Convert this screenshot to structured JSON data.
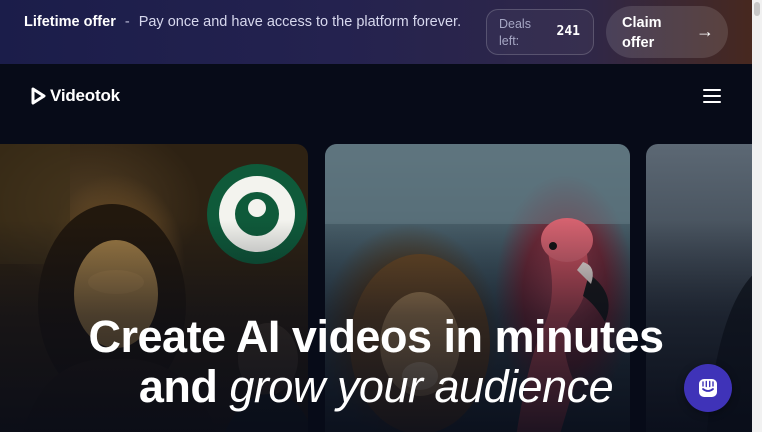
{
  "promo": {
    "title": "Lifetime offer",
    "separator": "-",
    "message": "Pay once and have access to the platform forever.",
    "deals_label": "Deals left:",
    "deals_count": "241",
    "claim_label": "Claim offer",
    "claim_icon": "arrow-right-icon",
    "claim_arrow": "→"
  },
  "nav": {
    "logo_icon": "play-icon",
    "brand": "Videotok",
    "menu_icon": "hamburger-menu-icon"
  },
  "gallery": {
    "cards": [
      {
        "subject": "mona-lisa-coffee-shop-image"
      },
      {
        "subject": "lion-and-flamingo-image"
      },
      {
        "subject": "partial-video-thumbnail-image"
      }
    ]
  },
  "hero": {
    "line1": "Create AI videos in minutes",
    "line2_prefix": "and",
    "line2_emphasis": "grow your audience"
  },
  "chat": {
    "icon": "chat-icon"
  },
  "colors": {
    "page_background": "#070b18",
    "promo_left": "#1b1d4a",
    "promo_right": "#47281f",
    "chat_button": "#3f33b8",
    "text": "#ffffff"
  }
}
